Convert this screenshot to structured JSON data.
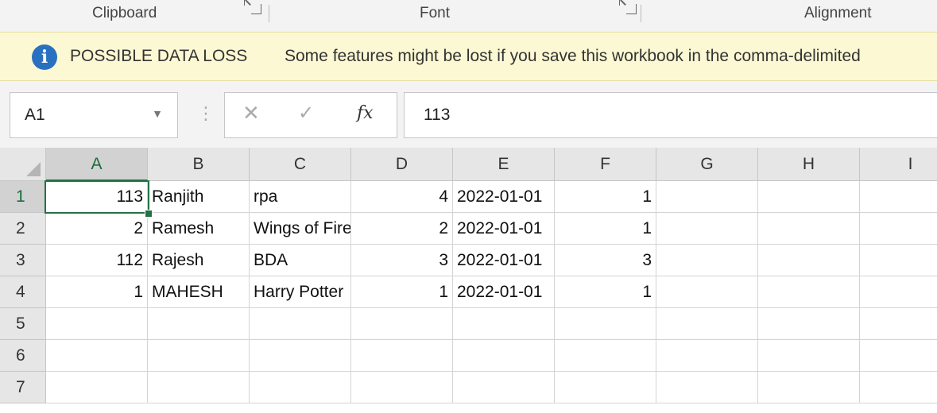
{
  "ribbon": {
    "groups": [
      {
        "label": "Clipboard"
      },
      {
        "label": "Font"
      },
      {
        "label": "Alignment"
      }
    ]
  },
  "message_bar": {
    "icon": "info-icon",
    "title": "POSSIBLE DATA LOSS",
    "text": "Some features might be lost if you save this workbook in the comma-delimited"
  },
  "formula_bar": {
    "name_box": "A1",
    "fx_label": "fx",
    "formula": "113"
  },
  "sheet": {
    "columns": [
      "A",
      "B",
      "C",
      "D",
      "E",
      "F",
      "G",
      "H",
      "I"
    ],
    "rows": [
      "1",
      "2",
      "3",
      "4",
      "5",
      "6",
      "7"
    ],
    "active_cell": "A1",
    "accent_color": "#217346",
    "data": [
      [
        "113",
        "Ranjith",
        "rpa",
        "4",
        "2022-01-01",
        "1"
      ],
      [
        "2",
        "Ramesh",
        "Wings of Fire",
        "2",
        "2022-01-01",
        "1"
      ],
      [
        "112",
        "Rajesh",
        "BDA",
        "3",
        "2022-01-01",
        "3"
      ],
      [
        "1",
        "MAHESH",
        "Harry Potter",
        "1",
        "2022-01-01",
        "1"
      ]
    ]
  }
}
